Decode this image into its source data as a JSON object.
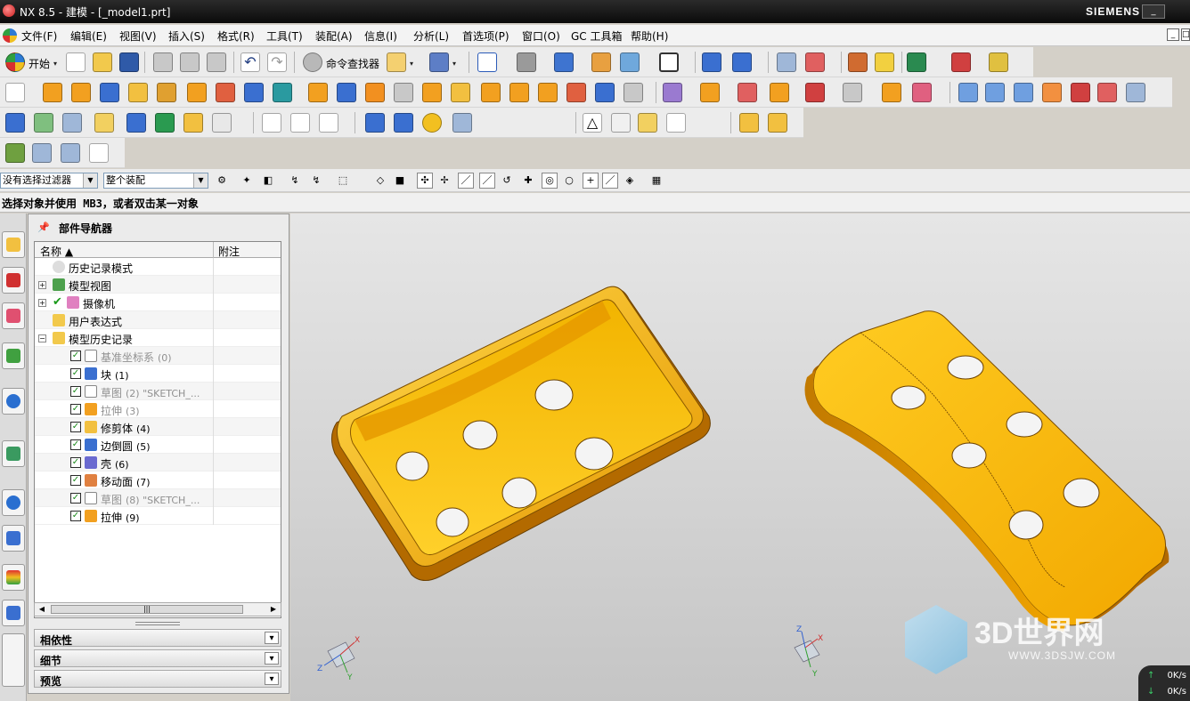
{
  "window": {
    "title": "NX 8.5 - 建模 - [_model1.prt]",
    "brand": "SIEMENS",
    "buttons": [
      "_",
      "□"
    ]
  },
  "menu": {
    "items": [
      "文件(F)",
      "编辑(E)",
      "视图(V)",
      "插入(S)",
      "格式(R)",
      "工具(T)",
      "装配(A)",
      "信息(I)",
      "分析(L)",
      "首选项(P)",
      "窗口(O)",
      "GC 工具箱",
      "帮助(H)"
    ],
    "mdi_buttons": [
      "_",
      "□"
    ]
  },
  "toolbar": {
    "start_label": "开始",
    "command_finder": "命令查找器"
  },
  "filter": {
    "type_filter": "没有选择过滤器",
    "scope": "整个装配"
  },
  "cue": "选择对象并使用 MB3，或者双击某一对象",
  "navigator": {
    "title": "部件导航器",
    "columns": {
      "name": "名称",
      "note": "附注"
    },
    "rows": [
      {
        "label": "历史记录模式",
        "num": "",
        "dim": false,
        "checked": false
      },
      {
        "label": "模型视图",
        "num": "",
        "dim": false,
        "checked": false
      },
      {
        "label": "摄像机",
        "num": "",
        "dim": false,
        "checked": true
      },
      {
        "label": "用户表达式",
        "num": "",
        "dim": false,
        "checked": false
      },
      {
        "label": "模型历史记录",
        "num": "",
        "dim": false,
        "checked": false
      },
      {
        "label": "基准坐标系",
        "num": "(0)",
        "dim": true,
        "checked": true
      },
      {
        "label": "块",
        "num": "(1)",
        "dim": false,
        "checked": true
      },
      {
        "label": "草图",
        "num": "(2) \"SKETCH_...",
        "dim": true,
        "checked": true
      },
      {
        "label": "拉伸",
        "num": "(3)",
        "dim": true,
        "checked": true
      },
      {
        "label": "修剪体",
        "num": "(4)",
        "dim": false,
        "checked": true
      },
      {
        "label": "边倒圆",
        "num": "(5)",
        "dim": false,
        "checked": true
      },
      {
        "label": "壳",
        "num": "(6)",
        "dim": false,
        "checked": true
      },
      {
        "label": "移动面",
        "num": "(7)",
        "dim": false,
        "checked": true
      },
      {
        "label": "草图",
        "num": "(8) \"SKETCH_...",
        "dim": true,
        "checked": true
      },
      {
        "label": "拉伸",
        "num": "(9)",
        "dim": false,
        "checked": true
      }
    ],
    "sections": [
      "相依性",
      "细节",
      "预览"
    ]
  },
  "viewport": {
    "triad_labels": [
      "X",
      "Y",
      "Z"
    ],
    "watermark": "3D世界网",
    "watermark_site": "WWW.3DSJW.COM",
    "part_color": "#f0a800"
  },
  "netstat": {
    "up": "0K/s",
    "down": "0K/s"
  }
}
